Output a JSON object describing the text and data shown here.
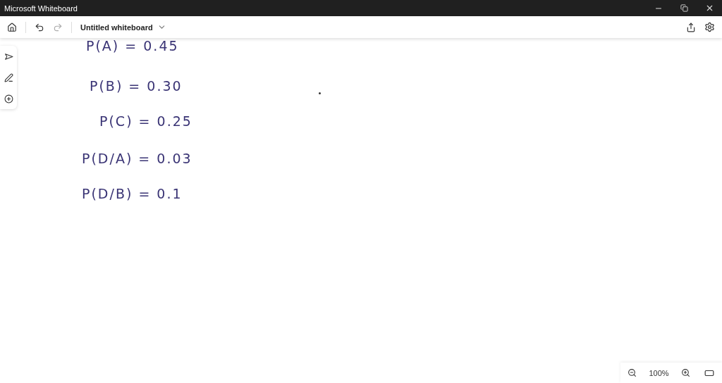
{
  "window": {
    "title": "Microsoft Whiteboard"
  },
  "toolbar": {
    "board_title": "Untitled whiteboard"
  },
  "canvas": {
    "ink": [
      {
        "text": "P(A) = 0.45"
      },
      {
        "text": "P(B) = 0.30"
      },
      {
        "text": "P(C) = 0.25"
      },
      {
        "text": "P(D/A) = 0.03"
      },
      {
        "text": "P(D/B) = 0.1"
      }
    ]
  },
  "zoom": {
    "reading": "100%"
  }
}
